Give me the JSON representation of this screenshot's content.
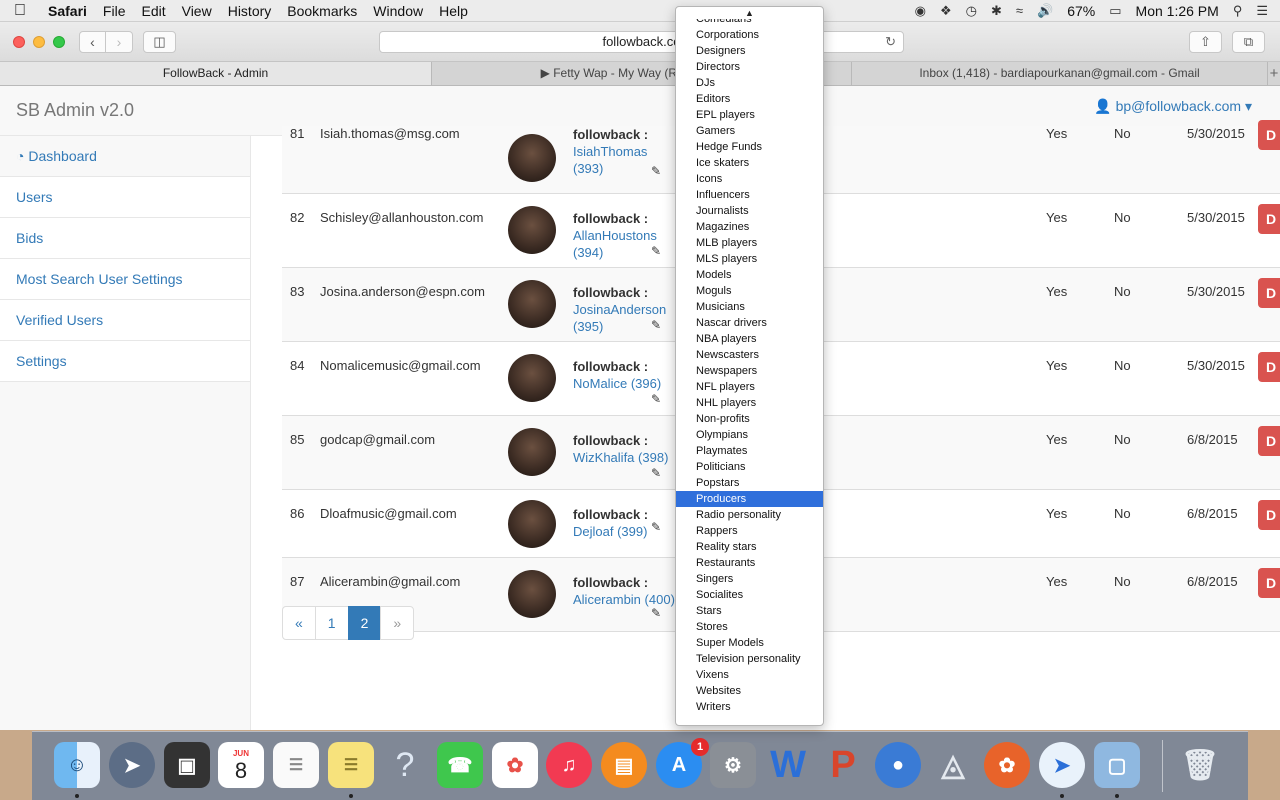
{
  "menubar": {
    "app": "Safari",
    "items": [
      "File",
      "Edit",
      "View",
      "History",
      "Bookmarks",
      "Window",
      "Help"
    ],
    "battery": "67%",
    "clock": "Mon 1:26 PM"
  },
  "browser": {
    "url": "followback.co",
    "tabs": [
      {
        "label": "FollowBack - Admin"
      },
      {
        "label": "▶ Fetty Wap - My Way (Remix) ft. Dra"
      },
      {
        "label": "Inbox (1,418) - bardiapourkanan@gmail.com - Gmail"
      }
    ]
  },
  "navbar": {
    "brand": "SB Admin v2.0",
    "user": "bp@followback.com"
  },
  "sidebar": {
    "items": [
      {
        "label": "Dashboard"
      },
      {
        "label": "Users"
      },
      {
        "label": "Bids"
      },
      {
        "label": "Most Search User Settings"
      },
      {
        "label": "Verified Users"
      },
      {
        "label": "Settings"
      }
    ]
  },
  "table": {
    "rows": [
      {
        "id": "81",
        "email": "Isiah.thomas@msg.com",
        "prefix": "followback :",
        "handle": "IsiahThomas",
        "count": "(393)",
        "verified": "Yes",
        "flag": "No",
        "date": "5/30/2015",
        "action": "D"
      },
      {
        "id": "82",
        "email": "Schisley@allanhouston.com",
        "prefix": "followback :",
        "handle": "AllanHoustons",
        "count": "(394)",
        "verified": "Yes",
        "flag": "No",
        "date": "5/30/2015",
        "action": "D"
      },
      {
        "id": "83",
        "email": "Josina.anderson@espn.com",
        "prefix": "followback :",
        "handle": "JosinaAnderson",
        "count": "(395)",
        "verified": "Yes",
        "flag": "No",
        "date": "5/30/2015",
        "action": "D"
      },
      {
        "id": "84",
        "email": "Nomalicemusic@gmail.com",
        "prefix": "followback :",
        "handle": "NoMalice",
        "count": "(396)",
        "verified": "Yes",
        "flag": "No",
        "date": "5/30/2015",
        "action": "D"
      },
      {
        "id": "85",
        "email": "godcap@gmail.com",
        "prefix": "followback :",
        "handle": "WizKhalifa",
        "count": "(398)",
        "verified": "Yes",
        "flag": "No",
        "date": "6/8/2015",
        "action": "D"
      },
      {
        "id": "86",
        "email": "Dloafmusic@gmail.com",
        "prefix": "followback :",
        "handle": "Dejloaf",
        "count": "(399)",
        "verified": "Yes",
        "flag": "No",
        "date": "6/8/2015",
        "action": "D"
      },
      {
        "id": "87",
        "email": "Alicerambin@gmail.com",
        "prefix": "followback :",
        "handle": "Alicerambin",
        "count": "(400)",
        "verified": "Yes",
        "flag": "No",
        "date": "6/8/2015",
        "action": "D"
      }
    ]
  },
  "pagination": {
    "prev": "«",
    "pages": [
      "1",
      "2"
    ],
    "active": "2",
    "next": "»"
  },
  "dropdown": {
    "selected": "Producers",
    "options": [
      "Comedians",
      "Corporations",
      "Designers",
      "Directors",
      "DJs",
      "Editors",
      "EPL players",
      "Gamers",
      "Hedge Funds",
      "Ice skaters",
      "Icons",
      "Influencers",
      "Journalists",
      "Magazines",
      "MLB players",
      "MLS players",
      "Models",
      "Moguls",
      "Musicians",
      "Nascar drivers",
      "NBA players",
      "Newscasters",
      "Newspapers",
      "NFL players",
      "NHL players",
      "Non-profits",
      "Olympians",
      "Playmates",
      "Politicians",
      "Popstars",
      "Producers",
      "Radio personality",
      "Rappers",
      "Reality stars",
      "Restaurants",
      "Singers",
      "Socialites",
      "Stars",
      "Stores",
      "Super Models",
      "Television personality",
      "Vixens",
      "Websites",
      "Writers"
    ]
  },
  "dock": {
    "calendar_month": "JUN",
    "calendar_day": "8",
    "appstore_badge": "1",
    "apps": [
      "finder-icon",
      "launchpad-icon",
      "photo-booth-icon",
      "calendar-icon",
      "reminders-icon",
      "notes-icon",
      "help-icon",
      "facetime-icon",
      "photos-icon",
      "itunes-icon",
      "ibooks-icon",
      "app-store-icon",
      "system-preferences-icon",
      "word-icon",
      "powerpoint-icon",
      "network-icon",
      "satellite-icon",
      "firefox-icon",
      "safari-icon",
      "preview-icon",
      "trash-icon"
    ]
  }
}
